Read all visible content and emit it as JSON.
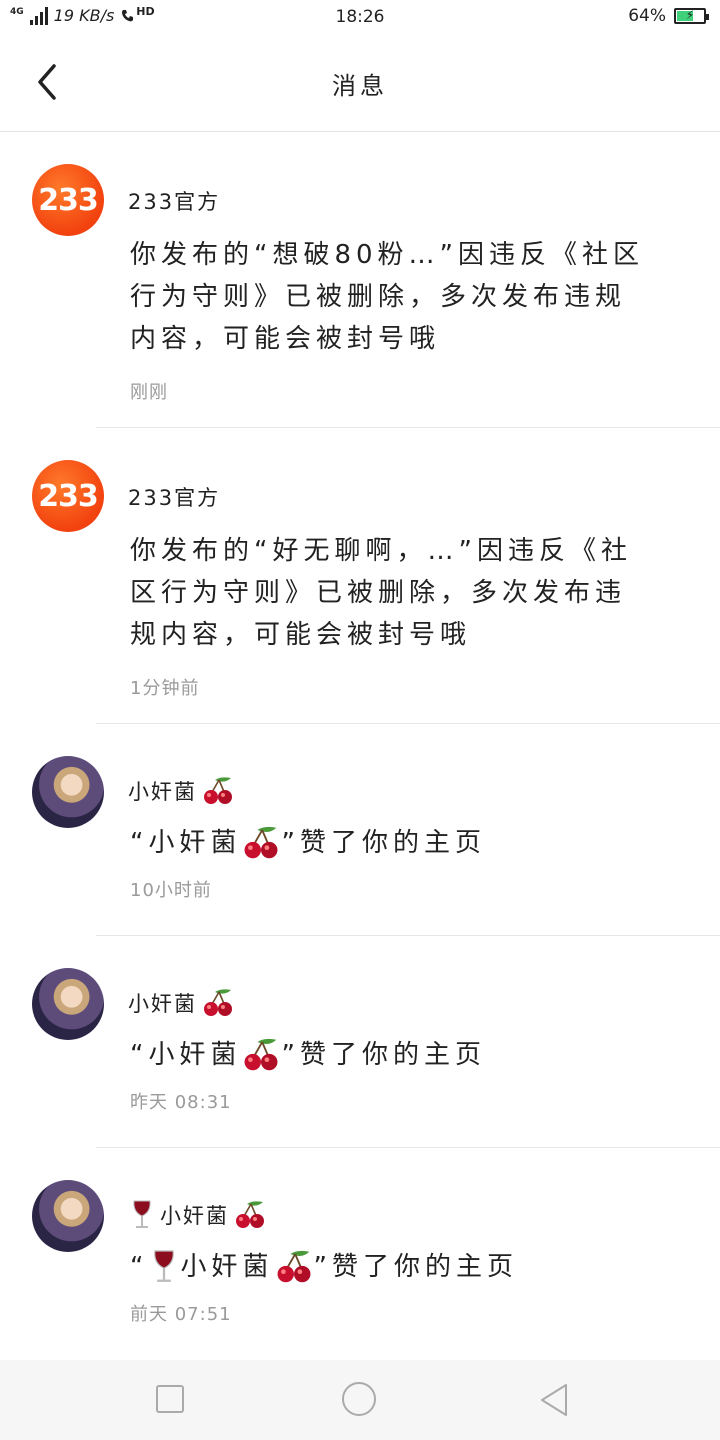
{
  "status_bar": {
    "network": "4G",
    "speed": "19 KB/s",
    "hd": "HD",
    "time": "18:26",
    "battery": "64%",
    "battery_level": 0.64
  },
  "header": {
    "title": "消息"
  },
  "messages": [
    {
      "sender": "233官方",
      "avatar_text": "233",
      "text": "你发布的“想破80粉…”因违反《社区行为守则》已被删除，多次发布违规内容，可能会被封号哦",
      "time": "刚刚"
    },
    {
      "sender": "233官方",
      "avatar_text": "233",
      "text": "你发布的“好无聊啊，…”因违反《社区行为守则》已被删除，多次发布违规内容，可能会被封号哦",
      "time": "1分钟前"
    },
    {
      "sender": "小奸菌",
      "text_prefix": "“小奸菌",
      "text_suffix": "”赞了你的主页",
      "time": "10小时前"
    },
    {
      "sender": "小奸菌",
      "text_prefix": "“小奸菌",
      "text_suffix": "”赞了你的主页",
      "time": "昨天 08:31"
    },
    {
      "sender": "小奸菌",
      "text_prefix": "“",
      "text_middle": "小奸菌",
      "text_suffix": "”赞了你的主页",
      "time": "前天 07:51"
    }
  ],
  "icons": {
    "back": "chevron-left-icon",
    "cherry": "cherry-icon",
    "wine": "wine-glass-icon",
    "nav_recent": "square-icon",
    "nav_home": "circle-icon",
    "nav_back": "triangle-back-icon"
  }
}
